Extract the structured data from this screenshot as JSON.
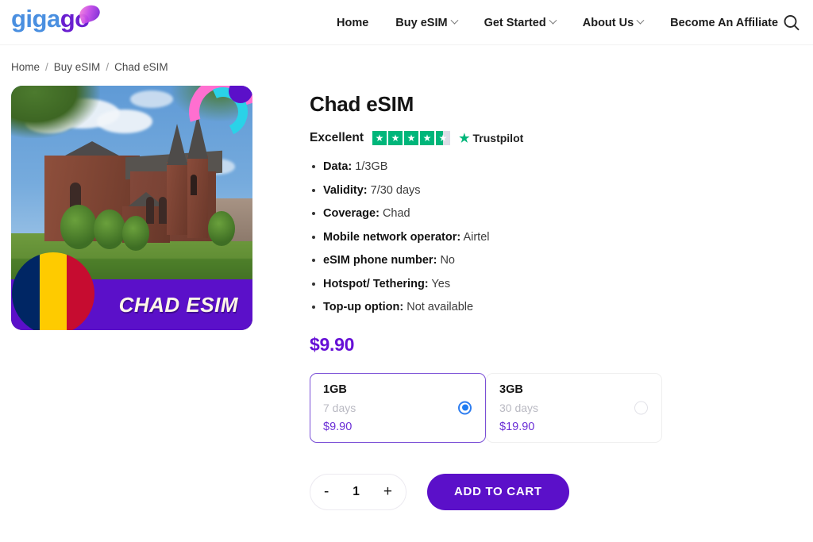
{
  "header": {
    "logo": {
      "part1": "giga",
      "part2": "go",
      "swoosh_icon": "swoosh-accent"
    },
    "nav": [
      {
        "label": "Home",
        "has_dropdown": false
      },
      {
        "label": "Buy eSIM",
        "has_dropdown": true
      },
      {
        "label": "Get Started",
        "has_dropdown": true
      },
      {
        "label": "About Us",
        "has_dropdown": true
      },
      {
        "label": "Become An Affiliate",
        "has_dropdown": false
      }
    ],
    "search_icon": "search-icon"
  },
  "breadcrumb": {
    "items": [
      "Home",
      "Buy eSIM",
      "Chad eSIM"
    ],
    "separator": "/"
  },
  "product": {
    "title": "Chad eSIM",
    "image": {
      "banner_text": "CHAD ESIM",
      "flag_colors": [
        "#002664",
        "#fecb00",
        "#c60c30"
      ],
      "banner_color": "#5b10c9"
    },
    "rating": {
      "word": "Excellent",
      "stars_filled": 4,
      "stars_total": 5,
      "has_half_star": true,
      "brand": "Trustpilot",
      "brand_color": "#00b67a"
    },
    "specs": [
      {
        "key": "Data:",
        "value": "1/3GB"
      },
      {
        "key": "Validity:",
        "value": "7/30 days"
      },
      {
        "key": "Coverage:",
        "value": "Chad"
      },
      {
        "key": "Mobile network operator:",
        "value": "Airtel"
      },
      {
        "key": "eSIM phone number:",
        "value": "No"
      },
      {
        "key": "Hotspot/ Tethering:",
        "value": "Yes"
      },
      {
        "key": "Top-up option:",
        "value": "Not available"
      }
    ],
    "price": "$9.90",
    "price_color": "#6610d6",
    "plans": [
      {
        "size": "1GB",
        "days": "7 days",
        "price": "$9.90",
        "selected": true
      },
      {
        "size": "3GB",
        "days": "30 days",
        "price": "$19.90",
        "selected": false
      }
    ],
    "quantity": {
      "decrement_label": "-",
      "value": "1",
      "increment_label": "+"
    },
    "add_to_cart_label": "ADD TO CART",
    "accent_color": "#5b10c9"
  }
}
